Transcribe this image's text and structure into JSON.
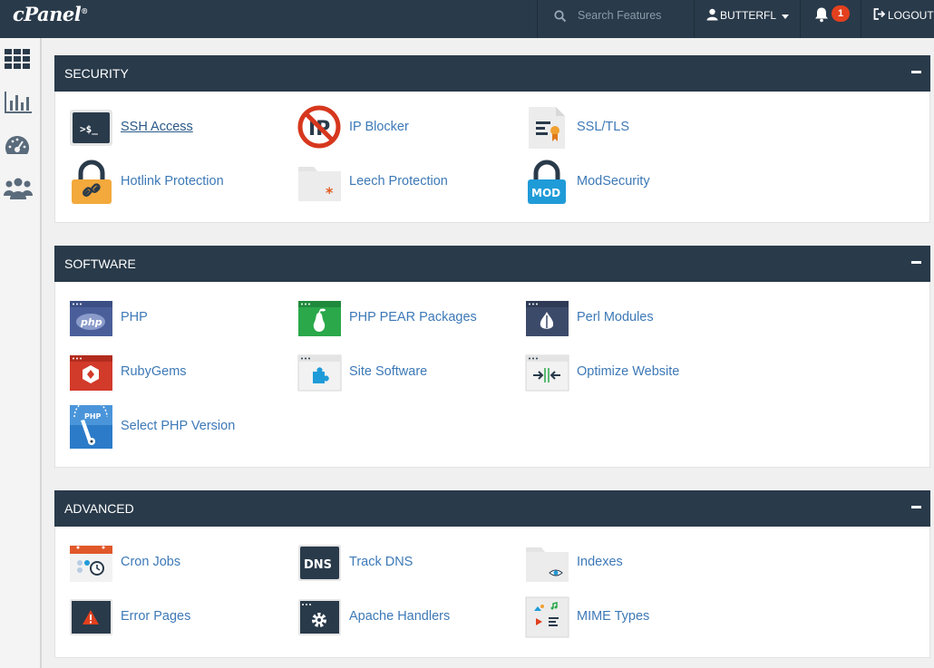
{
  "header": {
    "logo": "cPanel",
    "search_placeholder": "Search Features",
    "username": "BUTTERFL",
    "notification_count": "1",
    "logout_label": "LOGOUT"
  },
  "sidebar": {
    "items": [
      {
        "icon": "grid-icon"
      },
      {
        "icon": "bar-chart-icon"
      },
      {
        "icon": "dashboard-icon"
      },
      {
        "icon": "users-icon"
      }
    ]
  },
  "sections": [
    {
      "title": "SECURITY",
      "items": [
        {
          "label": "SSH Access",
          "icon": "terminal-icon"
        },
        {
          "label": "IP Blocker",
          "icon": "ip-blocker-icon"
        },
        {
          "label": "SSL/TLS",
          "icon": "certificate-icon"
        },
        {
          "label": "Hotlink Protection",
          "icon": "padlock-link-icon"
        },
        {
          "label": "Leech Protection",
          "icon": "folder-asterisk-icon"
        },
        {
          "label": "ModSecurity",
          "icon": "padlock-mod-icon"
        }
      ]
    },
    {
      "title": "SOFTWARE",
      "items": [
        {
          "label": "PHP",
          "icon": "php-window-icon"
        },
        {
          "label": "PHP PEAR Packages",
          "icon": "pear-window-icon"
        },
        {
          "label": "Perl Modules",
          "icon": "onion-window-icon"
        },
        {
          "label": "RubyGems",
          "icon": "ruby-window-icon"
        },
        {
          "label": "Site Software",
          "icon": "puzzle-window-icon"
        },
        {
          "label": "Optimize Website",
          "icon": "compress-window-icon"
        },
        {
          "label": "Select PHP Version",
          "icon": "php-gauge-icon"
        }
      ]
    },
    {
      "title": "ADVANCED",
      "items": [
        {
          "label": "Cron Jobs",
          "icon": "calendar-clock-icon"
        },
        {
          "label": "Track DNS",
          "icon": "dns-icon"
        },
        {
          "label": "Indexes",
          "icon": "folder-eye-icon"
        },
        {
          "label": "Error Pages",
          "icon": "warning-window-icon"
        },
        {
          "label": "Apache Handlers",
          "icon": "gear-window-icon"
        },
        {
          "label": "MIME Types",
          "icon": "media-file-icon"
        }
      ]
    }
  ],
  "colors": {
    "topbar": "#293a4a",
    "link": "#3d79b7",
    "badge": "#e4401e"
  }
}
